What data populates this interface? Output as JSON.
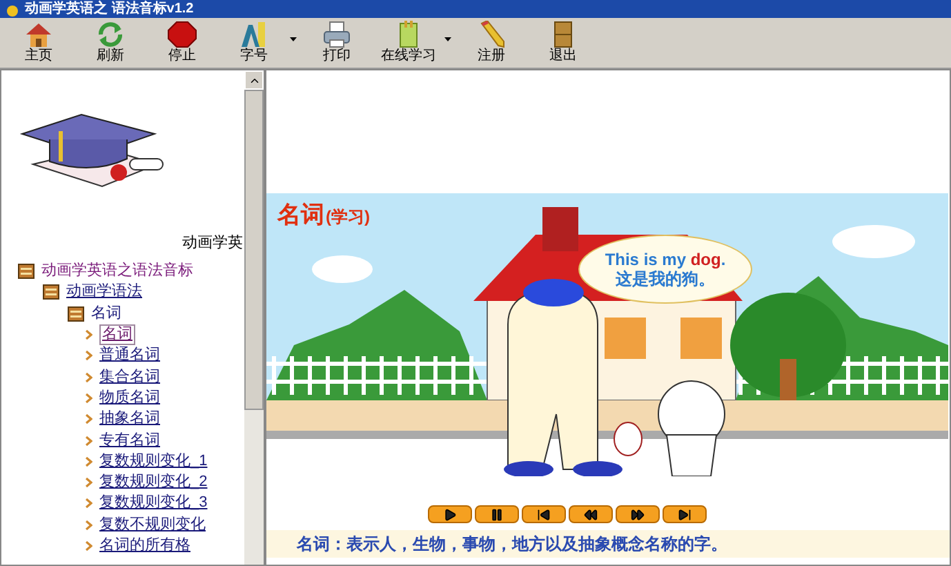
{
  "window": {
    "title": "动画学英语之 语法音标v1.2"
  },
  "toolbar": [
    {
      "label": "主页",
      "kind": "home",
      "dropdown": false
    },
    {
      "label": "刷新",
      "kind": "refresh",
      "dropdown": false
    },
    {
      "label": "停止",
      "kind": "stop",
      "dropdown": false
    },
    {
      "label": "字号",
      "kind": "font",
      "dropdown": true
    },
    {
      "label": "打印",
      "kind": "print",
      "dropdown": false
    },
    {
      "label": "在线学习",
      "kind": "book",
      "dropdown": true
    },
    {
      "label": "注册",
      "kind": "pencil",
      "dropdown": false
    },
    {
      "label": "退出",
      "kind": "exit",
      "dropdown": false
    }
  ],
  "sidebar": {
    "caption": "动画学英",
    "tree": [
      {
        "label": "动画学英语之语法音标",
        "link": false,
        "children": [
          {
            "label": "动画学语法",
            "link": true,
            "children": [
              {
                "label": "名词",
                "link": false,
                "children": [
                  {
                    "label": "名词",
                    "link": true,
                    "selected": true
                  },
                  {
                    "label": "普通名词",
                    "link": true,
                    "selected": false
                  },
                  {
                    "label": "集合名词",
                    "link": true,
                    "selected": false
                  },
                  {
                    "label": "物质名词",
                    "link": true,
                    "selected": false
                  },
                  {
                    "label": "抽象名词",
                    "link": true,
                    "selected": false
                  },
                  {
                    "label": "专有名词",
                    "link": true,
                    "selected": false
                  },
                  {
                    "label": "复数规则变化_1",
                    "link": true,
                    "selected": false
                  },
                  {
                    "label": "复数规则变化_2",
                    "link": true,
                    "selected": false
                  },
                  {
                    "label": "复数规则变化_3",
                    "link": true,
                    "selected": false
                  },
                  {
                    "label": "复数不规则变化",
                    "link": true,
                    "selected": false
                  },
                  {
                    "label": "名词的所有格",
                    "link": true,
                    "selected": false
                  }
                ]
              }
            ]
          }
        ]
      }
    ]
  },
  "lesson": {
    "title": "名词",
    "title_note": "(学习)",
    "bubble_en": "This is my **dog**.",
    "bubble_zh": "这是我的狗。",
    "controls": [
      {
        "kind": "play"
      },
      {
        "kind": "pause"
      },
      {
        "kind": "first"
      },
      {
        "kind": "rewind"
      },
      {
        "kind": "forward"
      },
      {
        "kind": "last"
      }
    ],
    "definition": "名词：表示人，生物，事物，地方以及抽象概念名称的字。"
  }
}
